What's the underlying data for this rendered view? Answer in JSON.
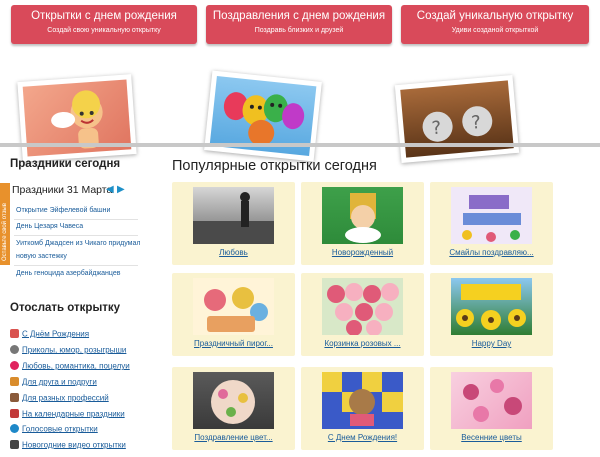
{
  "banners": [
    {
      "title": "Открытки с днем рождения",
      "subtitle": "Создай свою уникальную открытку"
    },
    {
      "title": "Поздравления с днем рождения",
      "subtitle": "Поздравь близких и друзей"
    },
    {
      "title": "Создай уникальную открытку",
      "subtitle": "Удиви созданой открыткой"
    }
  ],
  "side_tab": "Оставьте свой отзыв",
  "today": {
    "title": "Праздники сегодня",
    "date_label": "Праздники 31 Марта",
    "items": [
      "Открытие Эйфелевой башни",
      "День Цезаря Чавеса",
      "Уиткомб Джадсен из Чикаго придумал",
      "новую застежку",
      "День геноцида азербайджанцев"
    ]
  },
  "send": {
    "title": "Отослать открытку",
    "categories": [
      {
        "label": "С Днём Рождения",
        "icon": "gift-icon",
        "color": "#d9534f"
      },
      {
        "label": "Приколы, юмор, розыгрыши",
        "icon": "smiley-icon",
        "color": "#777777"
      },
      {
        "label": "Любовь, романтика, поцелуи",
        "icon": "heart-icon",
        "color": "#e0245e"
      },
      {
        "label": "Для друга и подруги",
        "icon": "friends-icon",
        "color": "#d98c2c"
      },
      {
        "label": "Для разных профессий",
        "icon": "person-icon",
        "color": "#8a5a3a"
      },
      {
        "label": "На календарные праздники",
        "icon": "calendar-icon",
        "color": "#c23a3a"
      },
      {
        "label": "Голосовые открытки",
        "icon": "microphone-icon",
        "color": "#1e88c8"
      },
      {
        "label": "Новогодние видео открытки",
        "icon": "video-icon",
        "color": "#444444"
      }
    ]
  },
  "popular": {
    "title": "Популярные открытки сегодня",
    "cards": [
      {
        "caption": "Любовь",
        "thumb": [
          "#6b6b6b",
          "#d6d6d6"
        ]
      },
      {
        "caption": "Новорожденный",
        "thumb": [
          "#2e8b3a",
          "#e0b43a"
        ]
      },
      {
        "caption": "Смайлы поздравляю...",
        "thumb": [
          "#8a6cc8",
          "#f0e8f8"
        ]
      },
      {
        "caption": "Праздничный пирог...",
        "thumb": [
          "#e8c040",
          "#e66a7a"
        ]
      },
      {
        "caption": "Корзинка розовых ...",
        "thumb": [
          "#e05a78",
          "#f7b0c0"
        ]
      },
      {
        "caption": "Happy Day",
        "thumb": [
          "#2f7d32",
          "#f5d020"
        ]
      },
      {
        "caption": "Поздравление цвет...",
        "thumb": [
          "#3a3a3a",
          "#e06a9a"
        ]
      },
      {
        "caption": "С Днем Рождения!",
        "thumb": [
          "#3a5ac8",
          "#f0d040"
        ]
      },
      {
        "caption": "Весенние цветы",
        "thumb": [
          "#f0a0c0",
          "#c84878"
        ]
      }
    ]
  },
  "colors": {
    "accent": "#d94a5a",
    "link": "#1a5c9a",
    "card_bg": "#faf3d0",
    "tab": "#e8912c"
  }
}
